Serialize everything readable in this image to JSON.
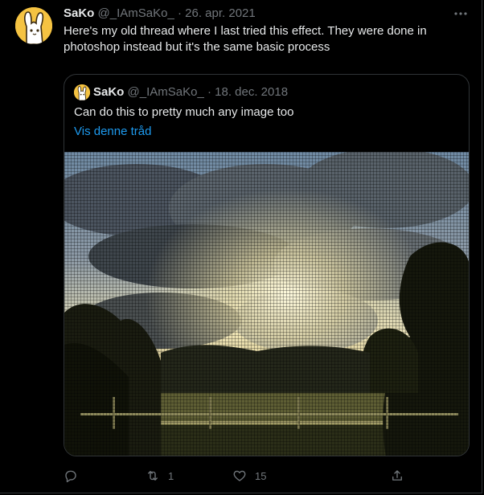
{
  "tweet": {
    "author": {
      "display_name": "SaKo",
      "handle": "@_IAmSaKo_",
      "separator": "·",
      "date": "26. apr. 2021"
    },
    "text": "Here's my old thread where I last tried this effect. They were done in photoshop instead but it's the same basic process",
    "more_icon": "more-dots-icon"
  },
  "quote": {
    "author": {
      "display_name": "SaKo",
      "handle": "@_IAmSaKo_",
      "separator": "·",
      "date": "18. dec. 2018"
    },
    "text": "Can do this to pretty much any image too",
    "show_thread_link": "Vis denne tråd",
    "image": "pixelated-sunset-landscape"
  },
  "actions": {
    "reply": {
      "icon": "reply-icon",
      "count": ""
    },
    "retweet": {
      "icon": "retweet-icon",
      "count": "1"
    },
    "like": {
      "icon": "heart-icon",
      "count": "15"
    },
    "share": {
      "icon": "share-icon",
      "count": ""
    }
  },
  "colors": {
    "background": "#000000",
    "text": "#e7e9ea",
    "muted": "#71767b",
    "link": "#1d9bf0",
    "border": "#2f3336",
    "avatar_bg": "#f5c342"
  }
}
